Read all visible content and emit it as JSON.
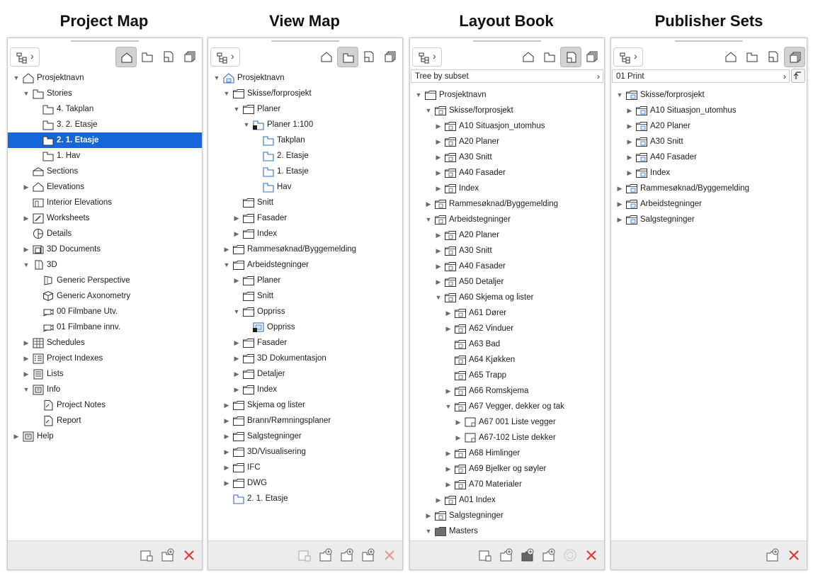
{
  "panels": [
    {
      "key": "project-map",
      "title": "Project Map",
      "active_mode": 0,
      "subset": null,
      "rows": [
        {
          "d": 0,
          "t": "open",
          "i": "project",
          "l": "Prosjektnavn"
        },
        {
          "d": 1,
          "t": "open",
          "i": "story",
          "l": "Stories"
        },
        {
          "d": 2,
          "t": "none",
          "i": "story",
          "l": "4. Takplan"
        },
        {
          "d": 2,
          "t": "none",
          "i": "story",
          "l": "3. 2. Etasje"
        },
        {
          "d": 2,
          "t": "none",
          "i": "story",
          "l": "2. 1. Etasje",
          "sel": true
        },
        {
          "d": 2,
          "t": "none",
          "i": "story",
          "l": "1. Hav"
        },
        {
          "d": 1,
          "t": "none",
          "i": "section",
          "l": "Sections"
        },
        {
          "d": 1,
          "t": "closed",
          "i": "elevation",
          "l": "Elevations"
        },
        {
          "d": 1,
          "t": "none",
          "i": "interior",
          "l": "Interior Elevations"
        },
        {
          "d": 1,
          "t": "closed",
          "i": "worksheet",
          "l": "Worksheets"
        },
        {
          "d": 1,
          "t": "none",
          "i": "detail",
          "l": "Details"
        },
        {
          "d": 1,
          "t": "closed",
          "i": "doc3d",
          "l": "3D Documents"
        },
        {
          "d": 1,
          "t": "open",
          "i": "cube3d",
          "l": "3D"
        },
        {
          "d": 2,
          "t": "none",
          "i": "perspective",
          "l": "Generic Perspective"
        },
        {
          "d": 2,
          "t": "none",
          "i": "axo",
          "l": "Generic Axonometry"
        },
        {
          "d": 2,
          "t": "none",
          "i": "camera",
          "l": "00 Filmbane Utv."
        },
        {
          "d": 2,
          "t": "none",
          "i": "camera",
          "l": "01 Filmbane innv."
        },
        {
          "d": 1,
          "t": "closed",
          "i": "schedule",
          "l": "Schedules"
        },
        {
          "d": 1,
          "t": "closed",
          "i": "index",
          "l": "Project Indexes"
        },
        {
          "d": 1,
          "t": "closed",
          "i": "list",
          "l": "Lists"
        },
        {
          "d": 1,
          "t": "open",
          "i": "info",
          "l": "Info"
        },
        {
          "d": 2,
          "t": "none",
          "i": "note",
          "l": "Project Notes"
        },
        {
          "d": 2,
          "t": "none",
          "i": "note",
          "l": "Report"
        },
        {
          "d": 0,
          "t": "closed",
          "i": "info",
          "l": "Help"
        }
      ],
      "footer": [
        "new-layout-icon",
        "new-view-icon",
        "delete-icon"
      ],
      "footer_enabled": [
        true,
        true,
        true
      ]
    },
    {
      "key": "view-map",
      "title": "View Map",
      "active_mode": 1,
      "subset": null,
      "rows": [
        {
          "d": 0,
          "t": "open",
          "i": "projectblue",
          "l": "Prosjektnavn"
        },
        {
          "d": 1,
          "t": "open",
          "i": "folder",
          "l": "Skisse/forprosjekt"
        },
        {
          "d": 2,
          "t": "open",
          "i": "folder",
          "l": "Planer"
        },
        {
          "d": 3,
          "t": "open",
          "i": "viewsettings",
          "l": "Planer 1:100"
        },
        {
          "d": 4,
          "t": "none",
          "i": "viewblue",
          "l": "Takplan"
        },
        {
          "d": 4,
          "t": "none",
          "i": "viewblue",
          "l": "2. Etasje"
        },
        {
          "d": 4,
          "t": "none",
          "i": "viewblue",
          "l": "1. Etasje"
        },
        {
          "d": 4,
          "t": "none",
          "i": "viewblue",
          "l": "Hav"
        },
        {
          "d": 2,
          "t": "none",
          "i": "folder",
          "l": "Snitt"
        },
        {
          "d": 2,
          "t": "closed",
          "i": "folder",
          "l": "Fasader"
        },
        {
          "d": 2,
          "t": "closed",
          "i": "folder",
          "l": "Index"
        },
        {
          "d": 1,
          "t": "closed",
          "i": "folder",
          "l": "Rammesøknad/Byggemelding"
        },
        {
          "d": 1,
          "t": "open",
          "i": "folder",
          "l": "Arbeidstegninger"
        },
        {
          "d": 2,
          "t": "closed",
          "i": "folder",
          "l": "Planer"
        },
        {
          "d": 2,
          "t": "none",
          "i": "folder",
          "l": "Snitt"
        },
        {
          "d": 2,
          "t": "open",
          "i": "folder",
          "l": "Oppriss"
        },
        {
          "d": 3,
          "t": "none",
          "i": "oppriss",
          "l": "Oppriss"
        },
        {
          "d": 2,
          "t": "closed",
          "i": "folder",
          "l": "Fasader"
        },
        {
          "d": 2,
          "t": "closed",
          "i": "folder",
          "l": "3D Dokumentasjon"
        },
        {
          "d": 2,
          "t": "closed",
          "i": "folder",
          "l": "Detaljer"
        },
        {
          "d": 2,
          "t": "closed",
          "i": "folder",
          "l": "Index"
        },
        {
          "d": 1,
          "t": "closed",
          "i": "folder",
          "l": "Skjema og lister"
        },
        {
          "d": 1,
          "t": "closed",
          "i": "folder",
          "l": "Brann/Rømningsplaner"
        },
        {
          "d": 1,
          "t": "closed",
          "i": "folder",
          "l": "Salgstegninger"
        },
        {
          "d": 1,
          "t": "closed",
          "i": "folder",
          "l": "3D/Visualisering"
        },
        {
          "d": 1,
          "t": "closed",
          "i": "folder",
          "l": "IFC"
        },
        {
          "d": 1,
          "t": "closed",
          "i": "folder",
          "l": "DWG"
        },
        {
          "d": 1,
          "t": "none",
          "i": "viewblue",
          "l": "2. 1. Etasje"
        }
      ],
      "footer": [
        "new-layout-icon",
        "new-subset-icon",
        "new-folder-icon",
        "new-view-icon",
        "delete-icon"
      ],
      "footer_enabled": [
        false,
        true,
        true,
        true,
        false
      ]
    },
    {
      "key": "layout-book",
      "title": "Layout Book",
      "active_mode": 2,
      "subset": "Tree by subset",
      "rows": [
        {
          "d": 0,
          "t": "open",
          "i": "folder",
          "l": "Prosjektnavn"
        },
        {
          "d": 1,
          "t": "open",
          "i": "subset",
          "l": "Skisse/forprosjekt"
        },
        {
          "d": 2,
          "t": "closed",
          "i": "subset",
          "l": "A10 Situasjon_utomhus"
        },
        {
          "d": 2,
          "t": "closed",
          "i": "subset",
          "l": "A20 Planer"
        },
        {
          "d": 2,
          "t": "closed",
          "i": "subset",
          "l": "A30 Snitt"
        },
        {
          "d": 2,
          "t": "closed",
          "i": "subset",
          "l": "A40 Fasader"
        },
        {
          "d": 2,
          "t": "closed",
          "i": "subset",
          "l": "Index"
        },
        {
          "d": 1,
          "t": "closed",
          "i": "subset",
          "l": "Rammesøknad/Byggemelding"
        },
        {
          "d": 1,
          "t": "open",
          "i": "subset",
          "l": "Arbeidstegninger"
        },
        {
          "d": 2,
          "t": "closed",
          "i": "subset",
          "l": "A20 Planer"
        },
        {
          "d": 2,
          "t": "closed",
          "i": "subset",
          "l": "A30 Snitt"
        },
        {
          "d": 2,
          "t": "closed",
          "i": "subset",
          "l": "A40 Fasader"
        },
        {
          "d": 2,
          "t": "closed",
          "i": "subset",
          "l": "A50 Detaljer"
        },
        {
          "d": 2,
          "t": "open",
          "i": "subset",
          "l": "A60 Skjema og lister"
        },
        {
          "d": 3,
          "t": "closed",
          "i": "subset",
          "l": "A61 Dører"
        },
        {
          "d": 3,
          "t": "closed",
          "i": "subset",
          "l": "A62 Vinduer"
        },
        {
          "d": 3,
          "t": "none",
          "i": "subset",
          "l": "A63 Bad"
        },
        {
          "d": 3,
          "t": "none",
          "i": "subset",
          "l": "A64 Kjøkken"
        },
        {
          "d": 3,
          "t": "none",
          "i": "subset",
          "l": "A65 Trapp"
        },
        {
          "d": 3,
          "t": "closed",
          "i": "subset",
          "l": "A66 Romskjema"
        },
        {
          "d": 3,
          "t": "open",
          "i": "subset",
          "l": "A67 Vegger, dekker og tak"
        },
        {
          "d": 4,
          "t": "closed",
          "i": "layout",
          "l": "A67 001 Liste vegger"
        },
        {
          "d": 4,
          "t": "closed",
          "i": "layout",
          "l": "A67-102 Liste dekker"
        },
        {
          "d": 3,
          "t": "closed",
          "i": "subset",
          "l": "A68 Himlinger"
        },
        {
          "d": 3,
          "t": "closed",
          "i": "subset",
          "l": "A69 Bjelker og søyler"
        },
        {
          "d": 3,
          "t": "closed",
          "i": "subset",
          "l": "A70 Materialer"
        },
        {
          "d": 2,
          "t": "closed",
          "i": "subset",
          "l": "A01 Index"
        },
        {
          "d": 1,
          "t": "closed",
          "i": "subset",
          "l": "Salgstegninger"
        },
        {
          "d": 1,
          "t": "open",
          "i": "masterfolder",
          "l": "Masters"
        }
      ],
      "footer": [
        "new-layout-icon",
        "new-subset-icon",
        "new-master-icon",
        "new-folder-icon",
        "refresh-icon",
        "delete-icon"
      ],
      "footer_enabled": [
        true,
        true,
        true,
        true,
        false,
        true
      ]
    },
    {
      "key": "publisher-sets",
      "title": "Publisher Sets",
      "active_mode": 3,
      "subset": "01 Print",
      "rows": [
        {
          "d": 0,
          "t": "open",
          "i": "pubfolder",
          "l": "Skisse/forprosjekt"
        },
        {
          "d": 1,
          "t": "closed",
          "i": "pubfolder",
          "l": "A10 Situasjon_utomhus"
        },
        {
          "d": 1,
          "t": "closed",
          "i": "pubfolder",
          "l": "A20 Planer"
        },
        {
          "d": 1,
          "t": "closed",
          "i": "pubfolder",
          "l": "A30 Snitt"
        },
        {
          "d": 1,
          "t": "closed",
          "i": "pubfolder",
          "l": "A40 Fasader"
        },
        {
          "d": 1,
          "t": "closed",
          "i": "pubfolder",
          "l": "Index"
        },
        {
          "d": 0,
          "t": "closed",
          "i": "pubfolder",
          "l": "Rammesøknad/Byggemelding"
        },
        {
          "d": 0,
          "t": "closed",
          "i": "pubfolder",
          "l": "Arbeidstegninger"
        },
        {
          "d": 0,
          "t": "closed",
          "i": "pubfolder",
          "l": "Salgstegninger"
        }
      ],
      "footer": [
        "new-folder-icon",
        "delete-icon"
      ],
      "footer_enabled": [
        true,
        true
      ]
    }
  ]
}
